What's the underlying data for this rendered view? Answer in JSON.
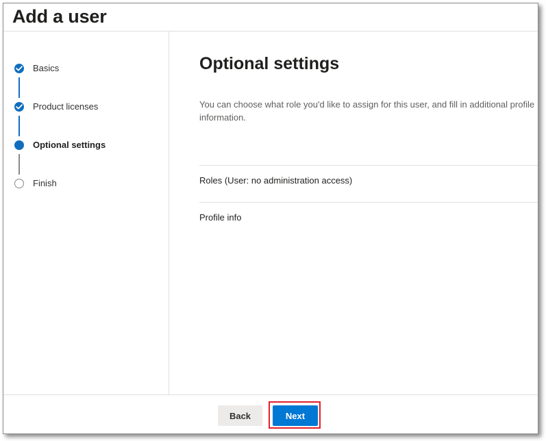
{
  "header": {
    "title": "Add a user"
  },
  "steps": [
    {
      "label": "Basics",
      "state": "done"
    },
    {
      "label": "Product licenses",
      "state": "done"
    },
    {
      "label": "Optional settings",
      "state": "current"
    },
    {
      "label": "Finish",
      "state": "pending"
    }
  ],
  "main": {
    "title": "Optional settings",
    "description": "You can choose what role you'd like to assign for this user, and fill in additional profile information.",
    "sections": [
      {
        "label": "Roles (User: no administration access)"
      },
      {
        "label": "Profile info"
      }
    ]
  },
  "footer": {
    "back_label": "Back",
    "next_label": "Next"
  },
  "colors": {
    "accent": "#0078d4",
    "highlight_outline": "#e0202a",
    "step_pending": "#8a8886"
  },
  "icons": {
    "step_done": "checkmark-icon"
  }
}
